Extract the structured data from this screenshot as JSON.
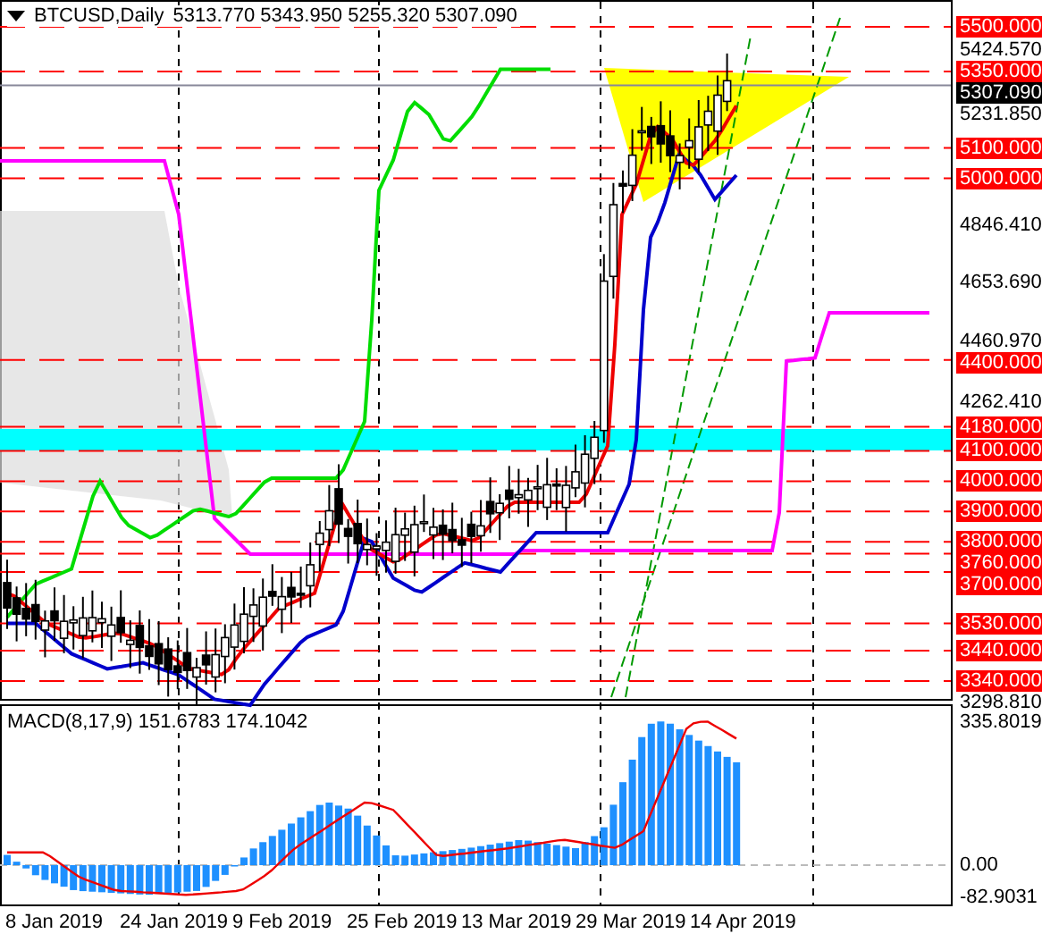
{
  "header": {
    "title": "BTCUSD,Daily",
    "ohlc": "5313.770 5343.950 5255.320 5307.090"
  },
  "price_axis": [
    {
      "text": "5500.000",
      "kind": "level"
    },
    {
      "text": "5424.570",
      "kind": "tick"
    },
    {
      "text": "5350.000",
      "kind": "level"
    },
    {
      "text": "5307.090",
      "kind": "current"
    },
    {
      "text": "5231.850",
      "kind": "tick"
    },
    {
      "text": "5100.000",
      "kind": "level"
    },
    {
      "text": "5000.000",
      "kind": "level"
    },
    {
      "text": "4846.410",
      "kind": "tick"
    },
    {
      "text": "4653.690",
      "kind": "tick"
    },
    {
      "text": "4460.970",
      "kind": "tick"
    },
    {
      "text": "4400.000",
      "kind": "level"
    },
    {
      "text": "4262.410",
      "kind": "tick"
    },
    {
      "text": "4180.000",
      "kind": "level"
    },
    {
      "text": "4100.000",
      "kind": "level"
    },
    {
      "text": "4000.000",
      "kind": "level"
    },
    {
      "text": "3900.000",
      "kind": "level"
    },
    {
      "text": "3800.000",
      "kind": "level"
    },
    {
      "text": "3760.000",
      "kind": "level"
    },
    {
      "text": "3700.000",
      "kind": "level"
    },
    {
      "text": "3530.000",
      "kind": "level"
    },
    {
      "text": "3440.000",
      "kind": "level"
    },
    {
      "text": "3340.000",
      "kind": "level"
    },
    {
      "text": "3298.810",
      "kind": "tick"
    }
  ],
  "macd": {
    "title": "MACD(8,17,9) 151.6783 174.1042",
    "axis": [
      "335.8019",
      "0.00",
      "-82.9031"
    ]
  },
  "date_axis": [
    "8 Jan 2019",
    "24 Jan 2019",
    "9 Feb 2019",
    "25 Feb 2019",
    "13 Mar 2019",
    "29 Mar 2019",
    "14 Apr 2019"
  ]
}
